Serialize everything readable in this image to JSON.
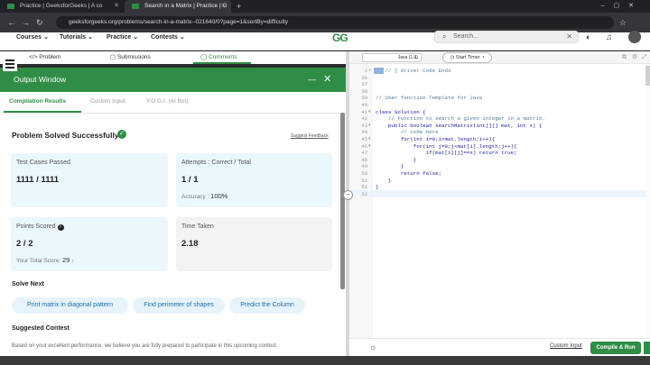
{
  "browser": {
    "tabs": [
      {
        "title": "Practice | GeeksforGeeks | A co",
        "active": false
      },
      {
        "title": "Search in a Matrix | Practice | G",
        "active": true
      }
    ],
    "url": "geeksforgeeks.org/problems/search-in-a-matrix--021640/0?page=1&sortBy=difficulty"
  },
  "site": {
    "nav": [
      "Courses",
      "Tutorials",
      "Practice",
      "Contests"
    ],
    "logo": "GG",
    "search_placeholder": "Search..."
  },
  "problem_tabs": [
    {
      "label": "</> Problem"
    },
    {
      "label": "Submissions"
    },
    {
      "label": "Comments"
    }
  ],
  "output_window": {
    "title": "Output Window",
    "tabs": [
      "Compilation Results",
      "Custom Input",
      "Y.O.G.I. (AI Bot)"
    ],
    "status": "Problem Solved Successfully",
    "suggest_feedback": "Suggest Feedback",
    "cards": {
      "test_cases": {
        "label": "Test Cases Passed",
        "value": "1111 / 1111"
      },
      "attempts": {
        "label": "Attempts : Correct / Total",
        "value": "1 / 1",
        "sub_label": "Accuracy :",
        "sub_value": "100%"
      },
      "points": {
        "label": "Points Scored",
        "value": "2 / 2",
        "sub_label": "Your Total Score:",
        "sub_value": "29"
      },
      "time": {
        "label": "Time Taken",
        "value": "2.18"
      }
    },
    "solve_next": {
      "heading": "Solve Next",
      "chips": [
        "Print matrix in diagonal pattern",
        "Find perimeter of shapes",
        "Predict the Column"
      ]
    },
    "suggested": {
      "heading": "Suggested Contest",
      "text": "Based on your excellent performance, we believe you are fully prepared to participate in this upcoming contest."
    }
  },
  "editor": {
    "language": "Java (1.8)",
    "timer_label": "Start Timer",
    "lines": [
      {
        "n": "1",
        "text": "   // } Driver Code Ends",
        "comment": true,
        "fold": "+"
      },
      {
        "n": "36",
        "text": "",
        "comment": false,
        "fold": ""
      },
      {
        "n": "37",
        "text": "",
        "comment": false,
        "fold": ""
      },
      {
        "n": "38",
        "text": "",
        "comment": false,
        "fold": ""
      },
      {
        "n": "39",
        "text": "// User function Template for Java",
        "comment": true,
        "fold": ""
      },
      {
        "n": "40",
        "text": "",
        "comment": false,
        "fold": ""
      },
      {
        "n": "41",
        "text": "class Solution {",
        "comment": false,
        "fold": "▾"
      },
      {
        "n": "42",
        "text": "    // Function to search a given integer in a matrix.",
        "comment": true,
        "fold": ""
      },
      {
        "n": "43",
        "text": "    public boolean searchMatrix(int[][] mat, int x) {",
        "comment": false,
        "fold": "▾"
      },
      {
        "n": "44",
        "text": "        // code here",
        "comment": true,
        "fold": ""
      },
      {
        "n": "45",
        "text": "        for(int i=0;i<mat.length;i++){",
        "comment": false,
        "fold": "▾"
      },
      {
        "n": "46",
        "text": "            for(int j=0;j<mat[i].length;j++){",
        "comment": false,
        "fold": "▾"
      },
      {
        "n": "47",
        "text": "                if(mat[i][j]==x) return true;",
        "comment": false,
        "fold": ""
      },
      {
        "n": "48",
        "text": "            }",
        "comment": false,
        "fold": ""
      },
      {
        "n": "49",
        "text": "        }",
        "comment": false,
        "fold": ""
      },
      {
        "n": "50",
        "text": "        return false;",
        "comment": false,
        "fold": ""
      },
      {
        "n": "51",
        "text": "    }",
        "comment": false,
        "fold": ""
      },
      {
        "n": "51",
        "text": "}",
        "comment": false,
        "fold": ""
      },
      {
        "n": "52",
        "text": "",
        "comment": false,
        "fold": ""
      }
    ],
    "custom_input": "Custom Input",
    "run_label": "Compile & Run"
  },
  "colors": {
    "brand_green": "#2f8d46",
    "chip_blue": "#1f6fa8"
  }
}
